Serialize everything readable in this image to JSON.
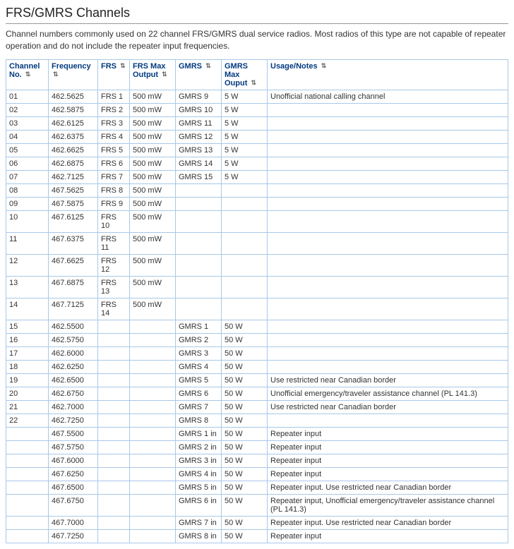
{
  "title": "FRS/GMRS Channels",
  "intro": "Channel numbers commonly used on 22 channel FRS/GMRS dual service radios. Most radios of this type are not capable of repeater operation and do not include the repeater input frequencies.",
  "columns": {
    "channel": "Channel No.",
    "frequency": "Frequency",
    "frs": "FRS",
    "frs_max": "FRS Max Output",
    "gmrs": "GMRS",
    "gmrs_max": "GMRS Max Ouput",
    "usage": "Usage/Notes"
  },
  "rows": [
    {
      "channel": "01",
      "frequency": "462.5625",
      "frs": "FRS 1",
      "frs_max": "500 mW",
      "gmrs": "GMRS 9",
      "gmrs_max": "5 W",
      "usage": "Unofficial national calling channel"
    },
    {
      "channel": "02",
      "frequency": "462.5875",
      "frs": "FRS 2",
      "frs_max": "500 mW",
      "gmrs": "GMRS 10",
      "gmrs_max": "5 W",
      "usage": ""
    },
    {
      "channel": "03",
      "frequency": "462.6125",
      "frs": "FRS 3",
      "frs_max": "500 mW",
      "gmrs": "GMRS 11",
      "gmrs_max": "5 W",
      "usage": ""
    },
    {
      "channel": "04",
      "frequency": "462.6375",
      "frs": "FRS 4",
      "frs_max": "500 mW",
      "gmrs": "GMRS 12",
      "gmrs_max": "5 W",
      "usage": ""
    },
    {
      "channel": "05",
      "frequency": "462.6625",
      "frs": "FRS 5",
      "frs_max": "500 mW",
      "gmrs": "GMRS 13",
      "gmrs_max": "5 W",
      "usage": ""
    },
    {
      "channel": "06",
      "frequency": "462.6875",
      "frs": "FRS 6",
      "frs_max": "500 mW",
      "gmrs": "GMRS 14",
      "gmrs_max": "5 W",
      "usage": ""
    },
    {
      "channel": "07",
      "frequency": "462.7125",
      "frs": "FRS 7",
      "frs_max": "500 mW",
      "gmrs": "GMRS 15",
      "gmrs_max": "5 W",
      "usage": ""
    },
    {
      "channel": "08",
      "frequency": "467.5625",
      "frs": "FRS 8",
      "frs_max": "500 mW",
      "gmrs": "",
      "gmrs_max": "",
      "usage": ""
    },
    {
      "channel": "09",
      "frequency": "467.5875",
      "frs": "FRS 9",
      "frs_max": "500 mW",
      "gmrs": "",
      "gmrs_max": "",
      "usage": ""
    },
    {
      "channel": "10",
      "frequency": "467.6125",
      "frs": "FRS 10",
      "frs_max": "500 mW",
      "gmrs": "",
      "gmrs_max": "",
      "usage": ""
    },
    {
      "channel": "11",
      "frequency": "467.6375",
      "frs": "FRS 11",
      "frs_max": "500 mW",
      "gmrs": "",
      "gmrs_max": "",
      "usage": ""
    },
    {
      "channel": "12",
      "frequency": "467.6625",
      "frs": "FRS 12",
      "frs_max": "500 mW",
      "gmrs": "",
      "gmrs_max": "",
      "usage": ""
    },
    {
      "channel": "13",
      "frequency": "467.6875",
      "frs": "FRS 13",
      "frs_max": "500 mW",
      "gmrs": "",
      "gmrs_max": "",
      "usage": ""
    },
    {
      "channel": "14",
      "frequency": "467.7125",
      "frs": "FRS 14",
      "frs_max": "500 mW",
      "gmrs": "",
      "gmrs_max": "",
      "usage": ""
    },
    {
      "channel": "15",
      "frequency": "462.5500",
      "frs": "",
      "frs_max": "",
      "gmrs": "GMRS 1",
      "gmrs_max": "50 W",
      "usage": ""
    },
    {
      "channel": "16",
      "frequency": "462.5750",
      "frs": "",
      "frs_max": "",
      "gmrs": "GMRS 2",
      "gmrs_max": "50 W",
      "usage": ""
    },
    {
      "channel": "17",
      "frequency": "462.6000",
      "frs": "",
      "frs_max": "",
      "gmrs": "GMRS 3",
      "gmrs_max": "50 W",
      "usage": ""
    },
    {
      "channel": "18",
      "frequency": "462.6250",
      "frs": "",
      "frs_max": "",
      "gmrs": "GMRS 4",
      "gmrs_max": "50 W",
      "usage": ""
    },
    {
      "channel": "19",
      "frequency": "462.6500",
      "frs": "",
      "frs_max": "",
      "gmrs": "GMRS 5",
      "gmrs_max": "50 W",
      "usage": "Use restricted near Canadian border"
    },
    {
      "channel": "20",
      "frequency": "462.6750",
      "frs": "",
      "frs_max": "",
      "gmrs": "GMRS 6",
      "gmrs_max": "50 W",
      "usage": "Unofficial emergency/traveler assistance channel (PL 141.3)"
    },
    {
      "channel": "21",
      "frequency": "462.7000",
      "frs": "",
      "frs_max": "",
      "gmrs": "GMRS 7",
      "gmrs_max": "50 W",
      "usage": "Use restricted near Canadian border"
    },
    {
      "channel": "22",
      "frequency": "462.7250",
      "frs": "",
      "frs_max": "",
      "gmrs": "GMRS 8",
      "gmrs_max": "50 W",
      "usage": ""
    },
    {
      "channel": "",
      "frequency": "467.5500",
      "frs": "",
      "frs_max": "",
      "gmrs": "GMRS 1 in",
      "gmrs_max": "50 W",
      "usage": "Repeater input"
    },
    {
      "channel": "",
      "frequency": "467.5750",
      "frs": "",
      "frs_max": "",
      "gmrs": "GMRS 2 in",
      "gmrs_max": "50 W",
      "usage": "Repeater input"
    },
    {
      "channel": "",
      "frequency": "467.6000",
      "frs": "",
      "frs_max": "",
      "gmrs": "GMRS 3 in",
      "gmrs_max": "50 W",
      "usage": "Repeater input"
    },
    {
      "channel": "",
      "frequency": "467.6250",
      "frs": "",
      "frs_max": "",
      "gmrs": "GMRS 4 in",
      "gmrs_max": "50 W",
      "usage": "Repeater input"
    },
    {
      "channel": "",
      "frequency": "467.6500",
      "frs": "",
      "frs_max": "",
      "gmrs": "GMRS 5 in",
      "gmrs_max": "50 W",
      "usage": "Repeater input. Use restricted near Canadian border"
    },
    {
      "channel": "",
      "frequency": "467.6750",
      "frs": "",
      "frs_max": "",
      "gmrs": "GMRS 6 in",
      "gmrs_max": "50 W",
      "usage": "Repeater input, Unofficial emergency/traveler assistance channel (PL 141.3)"
    },
    {
      "channel": "",
      "frequency": "467.7000",
      "frs": "",
      "frs_max": "",
      "gmrs": "GMRS 7 in",
      "gmrs_max": "50 W",
      "usage": "Repeater input. Use restricted near Canadian border"
    },
    {
      "channel": "",
      "frequency": "467.7250",
      "frs": "",
      "frs_max": "",
      "gmrs": "GMRS 8 in",
      "gmrs_max": "50 W",
      "usage": "Repeater input"
    }
  ]
}
